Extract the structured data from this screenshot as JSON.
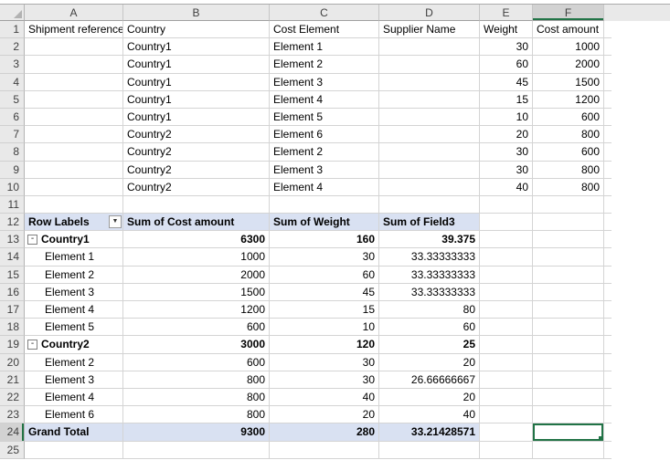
{
  "grid": {
    "column_headers": [
      "A",
      "B",
      "C",
      "D",
      "E",
      "F"
    ],
    "selected_cell": "F24",
    "selected_column": "F",
    "selected_row": "24",
    "icons": {
      "filter_glyph": "▼",
      "collapse_glyph": "-"
    },
    "colors": {
      "selection_accent": "#217346",
      "pivot_fill": "#D9E1F2",
      "header_fill": "#E9E9E9",
      "gridline": "#D4D4D4"
    }
  },
  "rows": [
    {
      "n": "1",
      "kind": "data-header",
      "cells": {
        "A": "Shipment reference",
        "B": "Country",
        "C": "Cost Element",
        "D": "Supplier Name",
        "E": "Weight",
        "F": "Cost amount"
      }
    },
    {
      "n": "2",
      "kind": "data",
      "cells": {
        "B": "Country1",
        "C": "Element 1",
        "E": "30",
        "F": "1000"
      }
    },
    {
      "n": "3",
      "kind": "data",
      "cells": {
        "B": "Country1",
        "C": "Element 2",
        "E": "60",
        "F": "2000"
      }
    },
    {
      "n": "4",
      "kind": "data",
      "cells": {
        "B": "Country1",
        "C": "Element 3",
        "E": "45",
        "F": "1500"
      }
    },
    {
      "n": "5",
      "kind": "data",
      "cells": {
        "B": "Country1",
        "C": "Element 4",
        "E": "15",
        "F": "1200"
      }
    },
    {
      "n": "6",
      "kind": "data",
      "cells": {
        "B": "Country1",
        "C": "Element 5",
        "E": "10",
        "F": "600"
      }
    },
    {
      "n": "7",
      "kind": "data",
      "cells": {
        "B": "Country2",
        "C": "Element 6",
        "E": "20",
        "F": "800"
      }
    },
    {
      "n": "8",
      "kind": "data",
      "cells": {
        "B": "Country2",
        "C": "Element 2",
        "E": "30",
        "F": "600"
      }
    },
    {
      "n": "9",
      "kind": "data",
      "cells": {
        "B": "Country2",
        "C": "Element 3",
        "E": "30",
        "F": "800"
      }
    },
    {
      "n": "10",
      "kind": "data",
      "cells": {
        "B": "Country2",
        "C": "Element 4",
        "E": "40",
        "F": "800"
      }
    },
    {
      "n": "11",
      "kind": "blank",
      "cells": {}
    },
    {
      "n": "12",
      "kind": "pivot-header",
      "cells": {
        "A": "Row Labels",
        "B": "Sum of Cost amount",
        "C": "Sum of Weight",
        "D": "Sum of Field3"
      }
    },
    {
      "n": "13",
      "kind": "pivot-group",
      "cells": {
        "A": "Country1",
        "B": "6300",
        "C": "160",
        "D": "39.375"
      }
    },
    {
      "n": "14",
      "kind": "pivot-item",
      "cells": {
        "A": "Element 1",
        "B": "1000",
        "C": "30",
        "D": "33.33333333"
      }
    },
    {
      "n": "15",
      "kind": "pivot-item",
      "cells": {
        "A": "Element 2",
        "B": "2000",
        "C": "60",
        "D": "33.33333333"
      }
    },
    {
      "n": "16",
      "kind": "pivot-item",
      "cells": {
        "A": "Element 3",
        "B": "1500",
        "C": "45",
        "D": "33.33333333"
      }
    },
    {
      "n": "17",
      "kind": "pivot-item",
      "cells": {
        "A": "Element 4",
        "B": "1200",
        "C": "15",
        "D": "80"
      }
    },
    {
      "n": "18",
      "kind": "pivot-item",
      "cells": {
        "A": "Element 5",
        "B": "600",
        "C": "10",
        "D": "60"
      }
    },
    {
      "n": "19",
      "kind": "pivot-group",
      "cells": {
        "A": "Country2",
        "B": "3000",
        "C": "120",
        "D": "25"
      }
    },
    {
      "n": "20",
      "kind": "pivot-item",
      "cells": {
        "A": "Element 2",
        "B": "600",
        "C": "30",
        "D": "20"
      }
    },
    {
      "n": "21",
      "kind": "pivot-item",
      "cells": {
        "A": "Element 3",
        "B": "800",
        "C": "30",
        "D": "26.66666667"
      }
    },
    {
      "n": "22",
      "kind": "pivot-item",
      "cells": {
        "A": "Element 4",
        "B": "800",
        "C": "40",
        "D": "20"
      }
    },
    {
      "n": "23",
      "kind": "pivot-item",
      "cells": {
        "A": "Element 6",
        "B": "800",
        "C": "20",
        "D": "40"
      }
    },
    {
      "n": "24",
      "kind": "pivot-total",
      "cells": {
        "A": "Grand Total",
        "B": "9300",
        "C": "280",
        "D": "33.21428571"
      }
    },
    {
      "n": "25",
      "kind": "blank",
      "cells": {}
    }
  ]
}
